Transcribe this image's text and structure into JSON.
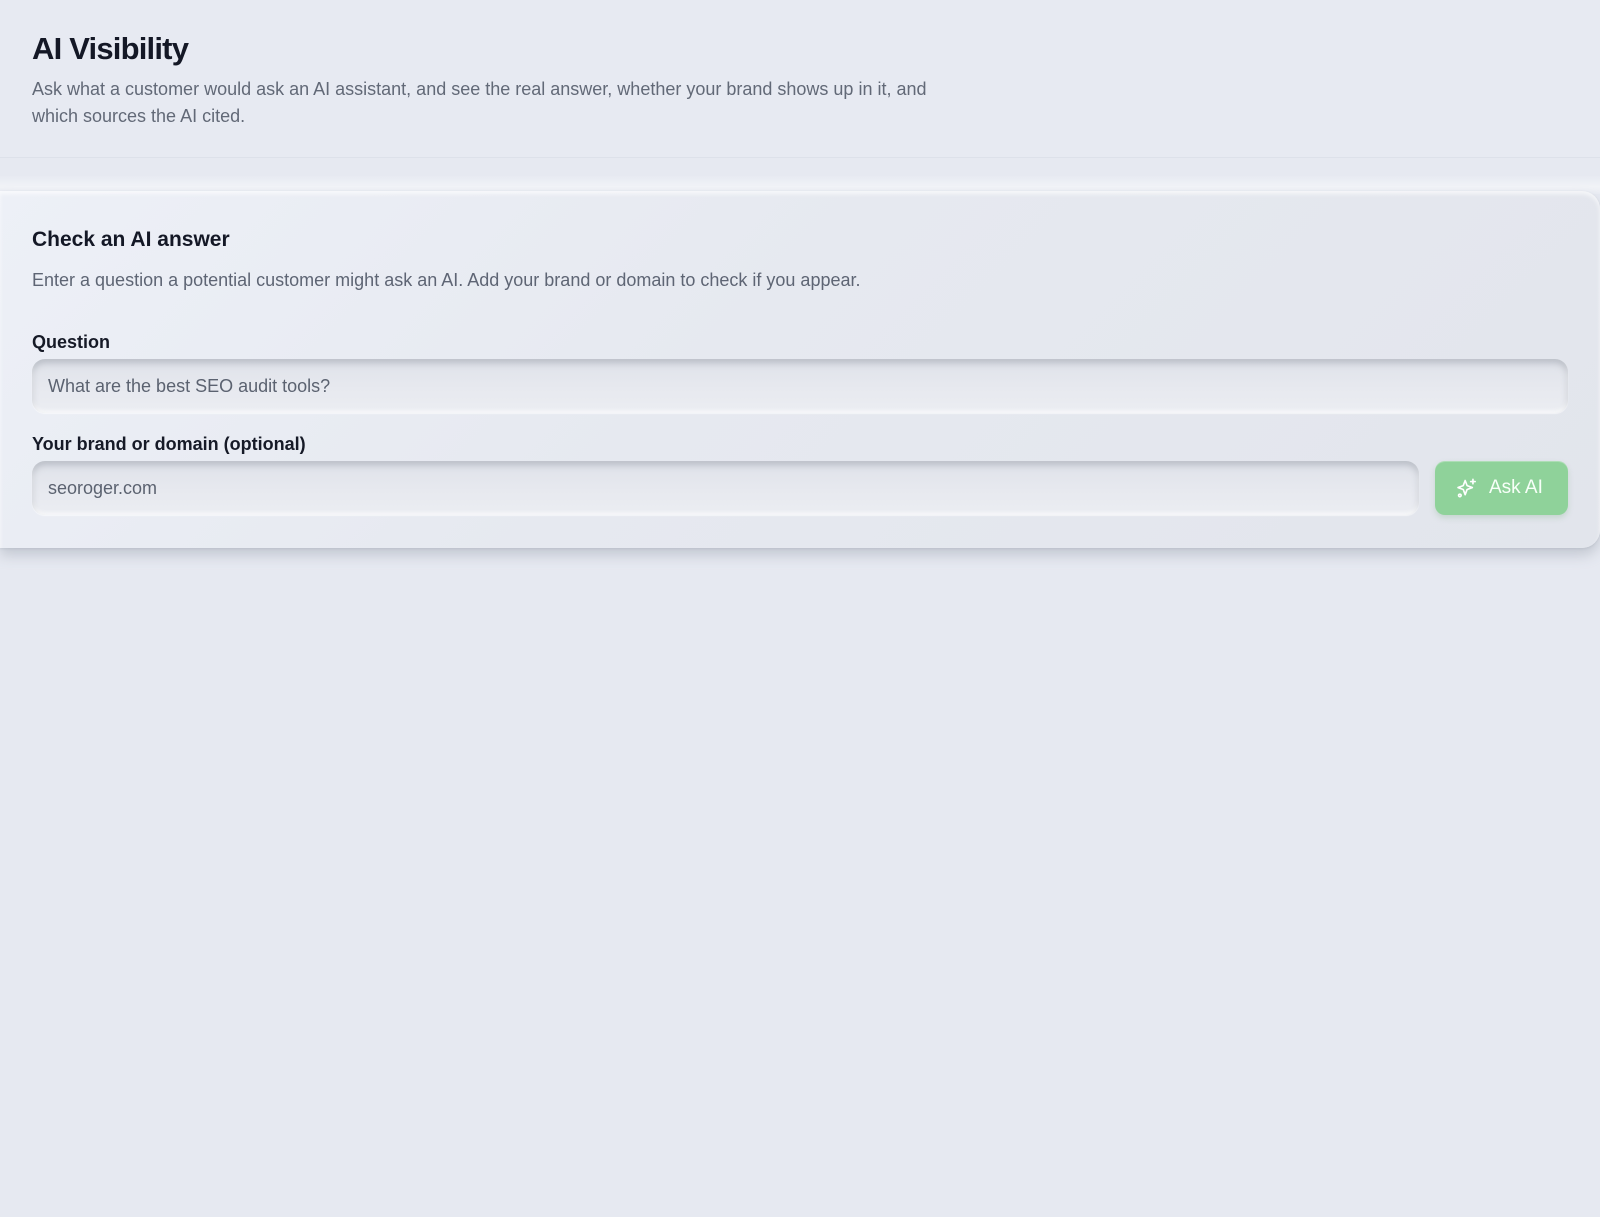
{
  "page": {
    "title": "AI Visibility",
    "subtitle": "Ask what a customer would ask an AI assistant, and see the real answer, whether your brand shows up in it, and which sources the AI cited."
  },
  "card": {
    "title": "Check an AI answer",
    "description": "Enter a question a potential customer might ask an AI. Add your brand or domain to check if you appear.",
    "question_label": "Question",
    "question_placeholder": "What are the best SEO audit tools?",
    "question_value": "",
    "brand_label": "Your brand or domain (optional)",
    "brand_placeholder": "seoroger.com",
    "brand_value": "",
    "button_label": "Ask AI",
    "button_icon": "sparkles-icon"
  },
  "colors": {
    "background": "#e6e9f1",
    "accent": "#8fd29a"
  }
}
